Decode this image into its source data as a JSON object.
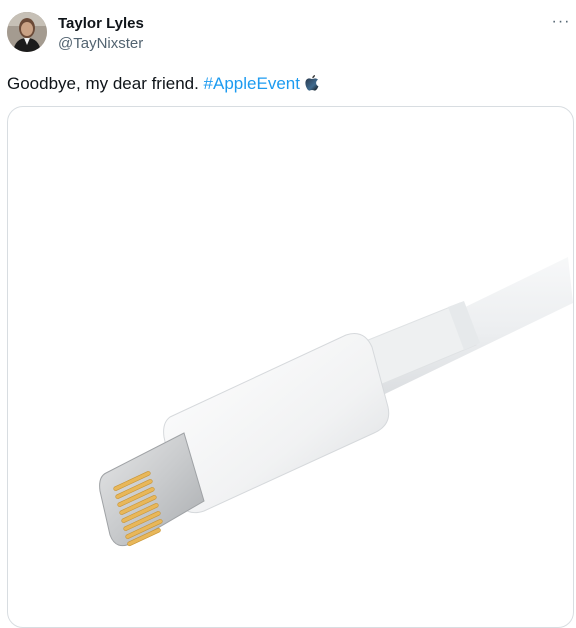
{
  "author": {
    "display_name": "Taylor Lyles",
    "handle": "@TayNixster",
    "avatar_icon": "person-avatar-icon"
  },
  "menu": {
    "more_glyph": "···"
  },
  "tweet": {
    "text_plain": "Goodbye, my dear friend. ",
    "hashtag": "#AppleEvent",
    "hashtag_icon": "apple-logo-icon",
    "link_color": "#1d9bf0"
  },
  "media": {
    "icon": "lightning-cable-icon"
  }
}
